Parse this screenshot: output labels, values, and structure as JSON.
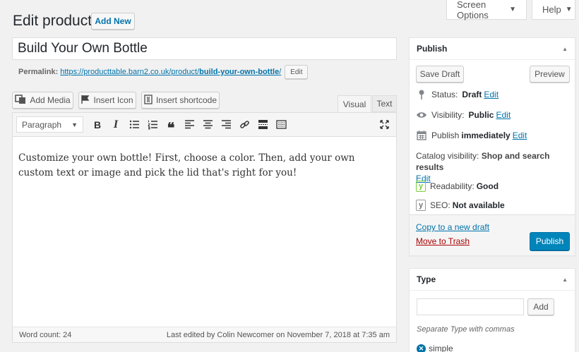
{
  "screen_meta": {
    "screen_options_label": "Screen Options",
    "help_label": "Help"
  },
  "header": {
    "title": "Edit product",
    "add_new_label": "Add New"
  },
  "post": {
    "title_value": "Build Your Own Bottle",
    "permalink_label": "Permalink:",
    "permalink_base": "https://producttable.barn2.co.uk/product/",
    "permalink_slug": "build-your-own-bottle",
    "permalink_tail": "/",
    "permalink_edit_label": "Edit"
  },
  "media_buttons": {
    "add_media": "Add Media",
    "insert_icon": "Insert Icon",
    "insert_shortcode": "Insert shortcode"
  },
  "editor": {
    "tab_visual": "Visual",
    "tab_text": "Text",
    "format_select": "Paragraph",
    "content": "Customize your own bottle! First, choose a color. Then, add your own custom text or image and pick the lid that's right for you!",
    "word_count": "Word count: 24",
    "last_edited": "Last edited by Colin Newcomer on November 7, 2018 at 7:35 am",
    "toolbar_icons": [
      "bold-icon",
      "italic-icon",
      "bulleted-list-icon",
      "numbered-list-icon",
      "blockquote-icon",
      "align-left-icon",
      "align-center-icon",
      "align-right-icon",
      "link-icon",
      "read-more-icon",
      "toolbar-toggle-icon",
      "fullscreen-icon"
    ]
  },
  "publish_box": {
    "title": "Publish",
    "save_draft": "Save Draft",
    "preview": "Preview",
    "status_label": "Status:",
    "status_value": "Draft",
    "visibility_label": "Visibility:",
    "visibility_value": "Public",
    "publish_label": "Publish",
    "publish_value": "immediately",
    "catalog_label": "Catalog visibility:",
    "catalog_value": "Shop and search results",
    "readability_label": "Readability:",
    "readability_value": "Good",
    "seo_label": "SEO:",
    "seo_value": "Not available",
    "edit_link": "Edit",
    "copy_draft": "Copy to a new draft",
    "move_trash": "Move to Trash",
    "publish_button": "Publish"
  },
  "type_box": {
    "title": "Type",
    "input_value": "",
    "add_label": "Add",
    "hint": "Separate Type with commas",
    "tags": [
      "simple"
    ]
  },
  "colors": {
    "accent": "#0073aa",
    "primary_button": "#0085ba",
    "trash": "#a00",
    "yoast_green": "#7ad03a"
  }
}
